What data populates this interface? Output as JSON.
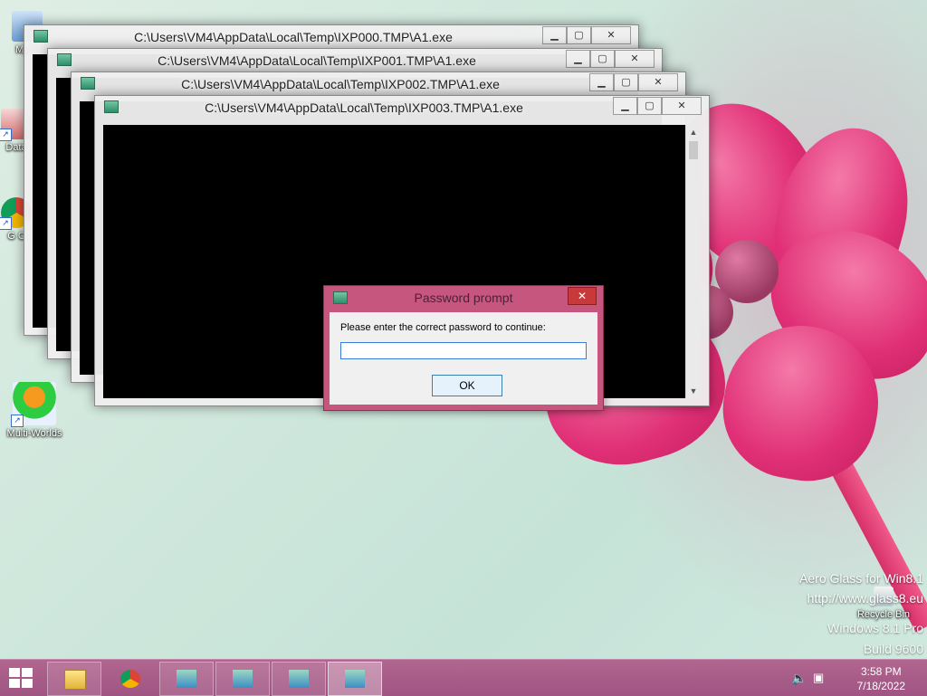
{
  "desktop": {
    "icons": [
      {
        "label": "My C",
        "icon": "computer-icon"
      },
      {
        "label": "Data",
        "icon": "data-shortcut-icon"
      },
      {
        "label": "G C",
        "icon": "chrome-shortcut-icon"
      },
      {
        "label": "Multi-Worlds",
        "icon": "multi-worlds-icon"
      },
      {
        "label": "Recycle Bin",
        "icon": "recycle-bin-icon"
      }
    ]
  },
  "windows": [
    {
      "title": "C:\\Users\\VM4\\AppData\\Local\\Temp\\IXP000.TMP\\A1.exe"
    },
    {
      "title": "C:\\Users\\VM4\\AppData\\Local\\Temp\\IXP001.TMP\\A1.exe"
    },
    {
      "title": "C:\\Users\\VM4\\AppData\\Local\\Temp\\IXP002.TMP\\A1.exe"
    },
    {
      "title": "C:\\Users\\VM4\\AppData\\Local\\Temp\\IXP003.TMP\\A1.exe"
    }
  ],
  "window_controls": {
    "minimize": "▁",
    "maximize": "▢",
    "close": "✕"
  },
  "dialog": {
    "title": "Password prompt",
    "prompt": "Please enter the correct password to continue:",
    "password_value": "",
    "ok_label": "OK",
    "close": "✕"
  },
  "watermark": {
    "line1": "Aero Glass for Win8.1",
    "line2": "http://www.glass8.eu",
    "line3": "Windows 8.1 Pro",
    "line4": "Build 9600"
  },
  "taskbar": {
    "items": [
      {
        "name": "file-explorer-icon"
      },
      {
        "name": "chrome-icon"
      },
      {
        "name": "installer-icon"
      },
      {
        "name": "installer-icon"
      },
      {
        "name": "installer-icon"
      },
      {
        "name": "installer-icon"
      }
    ],
    "time": "3:58 PM",
    "date": "7/18/2022"
  },
  "colors": {
    "taskbar": "#a85a88",
    "dialog_frame": "#c7567f",
    "petal": "#e02f76"
  }
}
